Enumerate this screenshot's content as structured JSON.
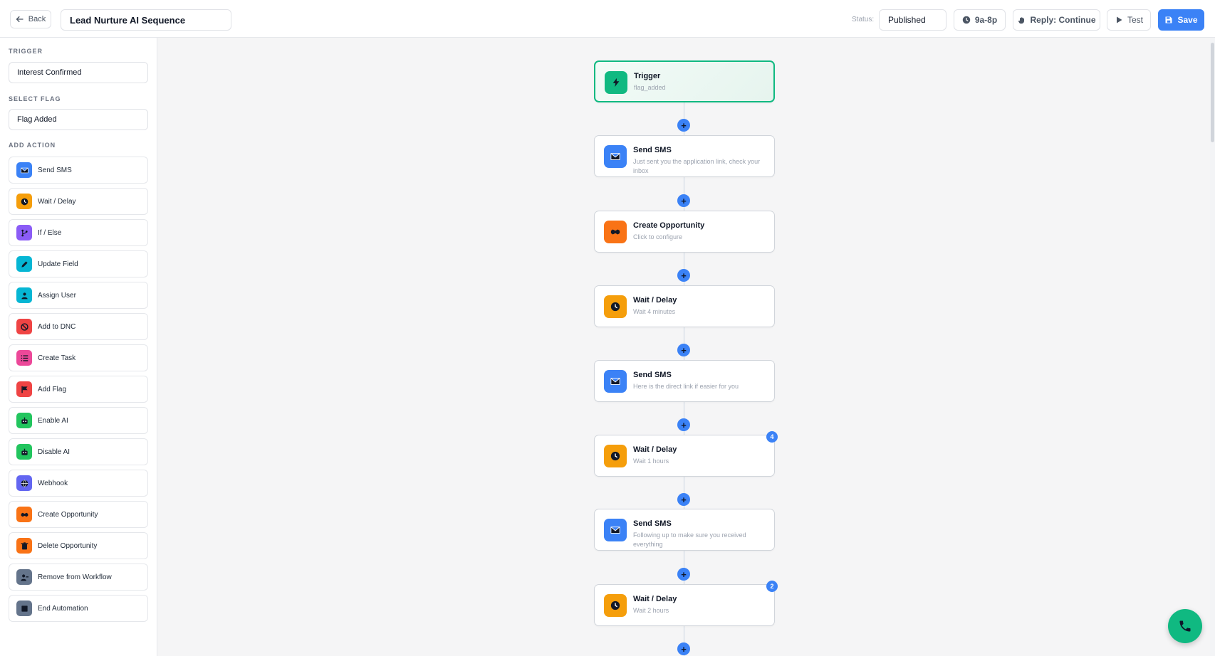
{
  "header": {
    "back_label": "Back",
    "title_value": "Lead Nurture AI Sequence",
    "status_label": "Status:",
    "status_value": "Published",
    "hours_label": "9a-8p",
    "reply_label": "Reply: Continue",
    "test_label": "Test",
    "save_label": "Save"
  },
  "sidebar": {
    "trigger_label": "TRIGGER",
    "trigger_value": "Interest Confirmed",
    "flag_label": "SELECT FLAG",
    "flag_value": "Flag Added",
    "add_action_label": "ADD ACTION",
    "actions": [
      {
        "label": "Send SMS",
        "icon": "envelope-icon",
        "color": "#3b82f6"
      },
      {
        "label": "Wait / Delay",
        "icon": "clock-icon",
        "color": "#f59e0b"
      },
      {
        "label": "If / Else",
        "icon": "branch-icon",
        "color": "#8b5cf6"
      },
      {
        "label": "Update Field",
        "icon": "pencil-icon",
        "color": "#06b6d4"
      },
      {
        "label": "Assign User",
        "icon": "user-icon",
        "color": "#06b6d4"
      },
      {
        "label": "Add to DNC",
        "icon": "ban-icon",
        "color": "#ef4444"
      },
      {
        "label": "Create Task",
        "icon": "list-icon",
        "color": "#ec4899"
      },
      {
        "label": "Add Flag",
        "icon": "flag-icon",
        "color": "#ef4444"
      },
      {
        "label": "Enable AI",
        "icon": "robot-icon",
        "color": "#22c55e"
      },
      {
        "label": "Disable AI",
        "icon": "robot-icon",
        "color": "#22c55e"
      },
      {
        "label": "Webhook",
        "icon": "globe-icon",
        "color": "#6366f1"
      },
      {
        "label": "Create Opportunity",
        "icon": "handshake-icon",
        "color": "#f97316"
      },
      {
        "label": "Delete Opportunity",
        "icon": "trash-icon",
        "color": "#f97316"
      },
      {
        "label": "Remove from Workflow",
        "icon": "user-minus-icon",
        "color": "#64748b"
      },
      {
        "label": "End Automation",
        "icon": "stop-icon",
        "color": "#64748b"
      }
    ]
  },
  "workflow": {
    "nodes": [
      {
        "title": "Trigger",
        "subtitle": "flag_added",
        "icon": "bolt-icon",
        "color": "#10b981",
        "badge": ""
      },
      {
        "title": "Send SMS",
        "subtitle": "Just sent you the application link, check your inbox",
        "icon": "envelope-icon",
        "color": "#3b82f6",
        "badge": ""
      },
      {
        "title": "Create Opportunity",
        "subtitle": "Click to configure",
        "icon": "handshake-icon",
        "color": "#f97316",
        "badge": ""
      },
      {
        "title": "Wait / Delay",
        "subtitle": "Wait 4 minutes",
        "icon": "clock-icon",
        "color": "#f59e0b",
        "badge": ""
      },
      {
        "title": "Send SMS",
        "subtitle": "Here is the direct link if easier for you",
        "icon": "envelope-icon",
        "color": "#3b82f6",
        "badge": ""
      },
      {
        "title": "Wait / Delay",
        "subtitle": "Wait 1 hours",
        "icon": "clock-icon",
        "color": "#f59e0b",
        "badge": "4"
      },
      {
        "title": "Send SMS",
        "subtitle": "Following up to make sure you received everything",
        "icon": "envelope-icon",
        "color": "#3b82f6",
        "badge": ""
      },
      {
        "title": "Wait / Delay",
        "subtitle": "Wait 2 hours",
        "icon": "clock-icon",
        "color": "#f59e0b",
        "badge": "2"
      }
    ],
    "plus_symbol": "+"
  },
  "colors": {
    "accent": "#3b82f6",
    "trigger_border": "#10b981",
    "phone_fab": "#10b981"
  }
}
